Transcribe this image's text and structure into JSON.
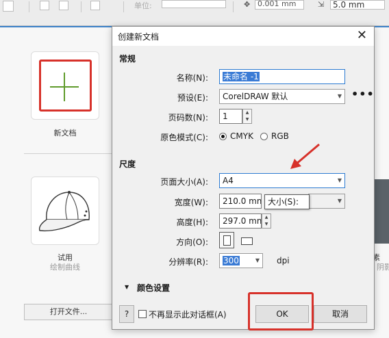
{
  "toolbar": {
    "value1": "0.001 mm",
    "value2": "5.0 mm",
    "unit_label": "单位:"
  },
  "welcome": {
    "new_doc_label": "新文档",
    "trial_label": "试用",
    "trial_sub": "绘制曲线",
    "open_file_label": "打开文件...",
    "right_label": "素",
    "right_sub": "阴影"
  },
  "dialog": {
    "title": "创建新文档",
    "section_general": "常规",
    "name_label": "名称(N):",
    "name_value": "未命名 -1",
    "preset_label": "预设(E):",
    "preset_value": "CorelDRAW 默认",
    "pages_label": "页码数(N):",
    "pages_value": "1",
    "color_mode_label": "原色模式(C):",
    "color_cmyk": "CMYK",
    "color_rgb": "RGB",
    "section_size": "尺度",
    "page_size_label": "页面大小(A):",
    "page_size_value": "A4",
    "width_label": "宽度(W):",
    "width_value": "210.0 mm",
    "height_label": "高度(H):",
    "height_value": "297.0 mm",
    "orientation_label": "方向(O):",
    "resolution_label": "分辨率(R):",
    "resolution_value": "300",
    "resolution_unit": "dpi",
    "tooltip": "大小(S):",
    "section_color": "颜色设置",
    "help_button": "?",
    "dont_show_label": "不再显示此对话框(A)",
    "ok_button": "OK",
    "cancel_button": "取消"
  },
  "colors": {
    "highlight_red": "#d7312a",
    "accent_blue": "#3a80c8",
    "plus_green": "#5f9b2b"
  }
}
